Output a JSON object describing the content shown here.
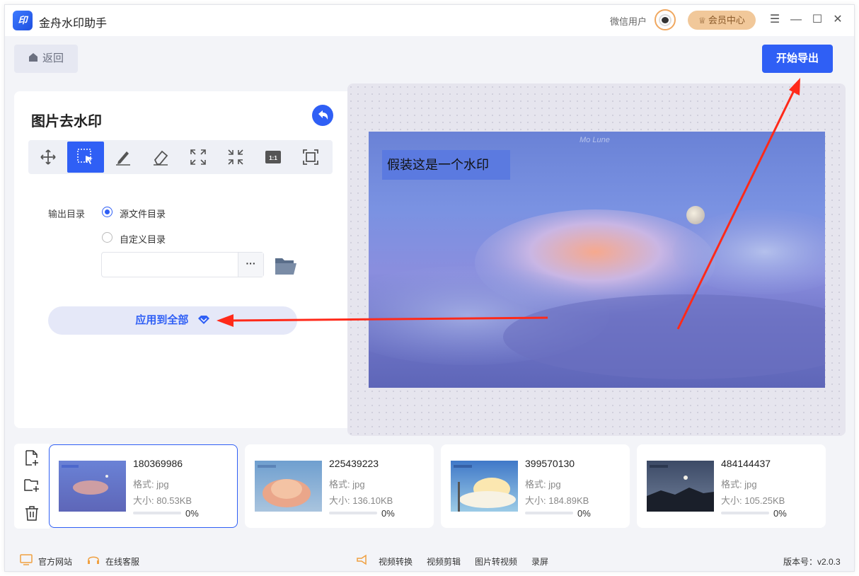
{
  "app": {
    "title": "金舟水印助手",
    "logo_text": "印"
  },
  "header": {
    "user_name": "微信用户",
    "vip_label": "会员中心"
  },
  "nav": {
    "back_label": "返回",
    "export_label": "开始导出"
  },
  "panel": {
    "title": "图片去水印",
    "tools": [
      "move-icon",
      "select-region-icon",
      "brush-icon",
      "eraser-icon",
      "fit-screen-icon",
      "shrink-screen-icon",
      "actual-size-icon",
      "frame-icon"
    ],
    "actual_size_label": "1:1",
    "output_label": "输出目录",
    "option_source": "源文件目录",
    "option_custom": "自定义目录",
    "custom_dir_value": "",
    "browse_label": "···",
    "apply_label": "应用到全部"
  },
  "preview": {
    "watermark_text": "假装这是一个水印",
    "signature_text": "Mo Lune"
  },
  "files": [
    {
      "name": "180369986",
      "format": "格式: jpg",
      "size": "大小: 80.53KB",
      "progress": 0,
      "progress_label": "0%",
      "selected": true
    },
    {
      "name": "225439223",
      "format": "格式: jpg",
      "size": "大小: 136.10KB",
      "progress": 0,
      "progress_label": "0%",
      "selected": false
    },
    {
      "name": "399570130",
      "format": "格式: jpg",
      "size": "大小: 184.89KB",
      "progress": 0,
      "progress_label": "0%",
      "selected": false
    },
    {
      "name": "484144437",
      "format": "格式: jpg",
      "size": "大小: 105.25KB",
      "progress": 0,
      "progress_label": "0%",
      "selected": false
    }
  ],
  "footer": {
    "official_site": "官方网站",
    "online_service": "在线客服",
    "video_convert": "视频转换",
    "video_edit": "视频剪辑",
    "image_to_video": "图片转视频",
    "screen_record": "录屏",
    "version": "版本号：v2.0.3"
  },
  "colors": {
    "accent": "#2f5ff5",
    "vip": "#f1c89a",
    "arrow": "#ff2a1a"
  }
}
